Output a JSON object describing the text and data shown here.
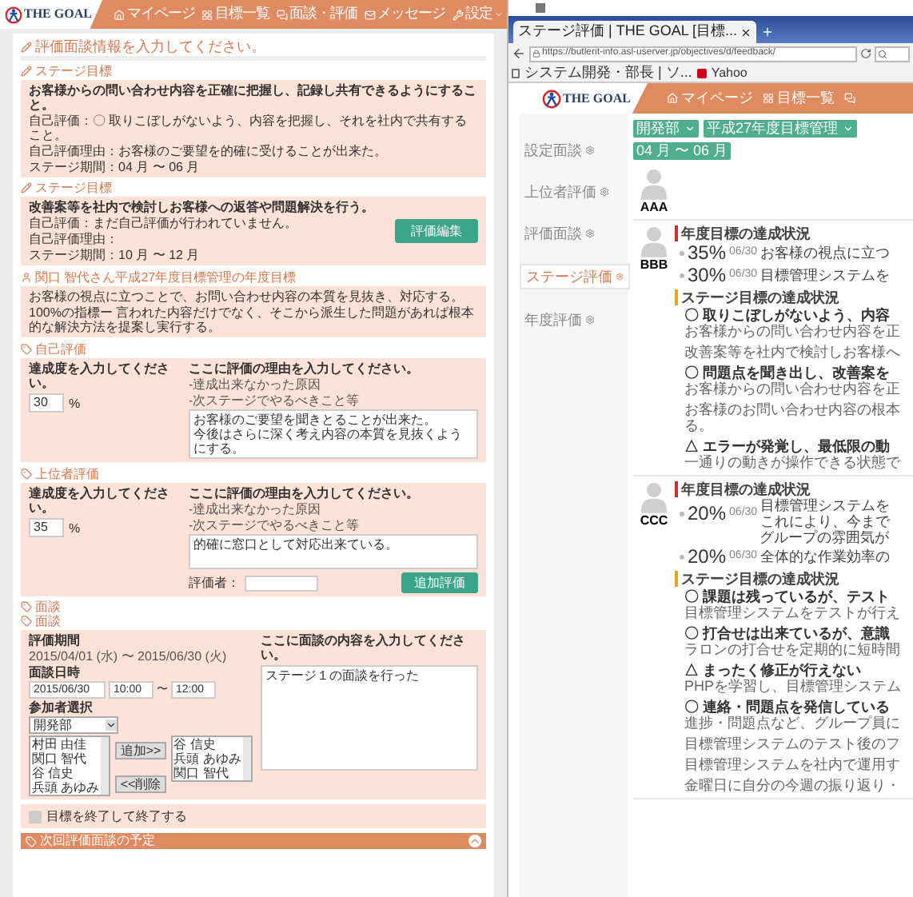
{
  "left": {
    "nav": {
      "logo": "THE GOAL",
      "items": [
        {
          "kind": "home",
          "label": "マイページ",
          "menu": false
        },
        {
          "kind": "grid",
          "label": "目標一覧",
          "menu": false
        },
        {
          "kind": "chat",
          "label": "面談・評価",
          "menu": false
        },
        {
          "kind": "mail",
          "label": "メッセージ",
          "menu": false
        },
        {
          "kind": "wrench",
          "label": "設定",
          "menu": true
        }
      ]
    },
    "title": "評価面談情報を入力してください。",
    "stage_goals": [
      {
        "heading": "ステージ目標",
        "goal": "お客様からの問い合わせ内容を正確に把握し、記録し共有できるようにすること。",
        "lines": [
          "自己評価：〇 取りこぼしがないよう、内容を把握し、それを社内で共有すること。",
          "自己評価理由：お客様のご要望を的確に受けることが出来た。",
          "ステージ期間：04 月 〜 06 月"
        ]
      },
      {
        "heading": "ステージ目標",
        "goal": "改善案等を社内で検討しお客様への返答や問題解決を行う。",
        "lines": [
          "自己評価：まだ自己評価が行われていません。",
          "自己評価理由：",
          "ステージ期間：10 月 〜 12 月"
        ],
        "button": "評価編集"
      }
    ],
    "annual": {
      "heading": "関口 智代さん平成27年度目標管理の年度目標",
      "lines": [
        "お客様の視点に立つことで、お問い合わせ内容の本質を見抜き、対応する。",
        "100%の指標ー 言われた内容だけでなく、そこから派生した問題があれば根本的な解決方法を提案し実行する。"
      ]
    },
    "evaluations": [
      {
        "heading": "自己評価",
        "prompt": "達成度を入力してください。",
        "percent": "30",
        "unit": "%",
        "reason_prompt": "ここに評価の理由を入力してください。",
        "hints": [
          "-達成出来なかった原因",
          "-次ステージでやるべきこと等"
        ],
        "reason": [
          "お客様のご要望を聞きとることが出来た。",
          "今後はさらに深く考え内容の本質を見抜くようにする。"
        ]
      },
      {
        "heading": "上位者評価",
        "prompt": "達成度を入力してください。",
        "percent": "35",
        "unit": "%",
        "reason_prompt": "ここに評価の理由を入力してください。",
        "hints": [
          "-達成出来なかった原因",
          "-次ステージでやるべきこと等"
        ],
        "reason": [
          "的確に窓口として対応出来ている。"
        ],
        "evaluator_label": "評価者：",
        "button": "追加評価"
      }
    ],
    "meeting": {
      "headings": [
        "面談",
        "面談"
      ],
      "period_label": "評価期間",
      "period": "2015/04/01 (水) 〜 2015/06/30 (火)",
      "datetime_label": "面談日時",
      "date": "2015/06/30",
      "start": "10:00",
      "separator": "〜",
      "end": "12:00",
      "participants_label": "参加者選択",
      "department": "開発部",
      "candidates": [
        "村田 由佳",
        "関口 智代",
        "谷 信史",
        "兵頭 あゆみ"
      ],
      "add_button": "追加>>",
      "remove_button": "<<削除",
      "selected": [
        "谷 信史",
        "兵頭 あゆみ",
        "関口 智代"
      ],
      "content_prompt": "ここに面談の内容を入力してください。",
      "content": "ステージ１の面談を行った"
    },
    "finish": {
      "label": "目標を終了して終了する",
      "checked": false
    },
    "next": {
      "heading": "次回評価面談の予定"
    }
  },
  "right": {
    "browser": {
      "tab": "ステージ評価 | THE GOAL [目標...",
      "url": "https://butlerit-info.asl-userver.jp/objectives/d/feedback/",
      "bookmarks": [
        "システム開発・部長 | ソ...",
        "Yahoo"
      ]
    },
    "nav": {
      "logo": "THE GOAL",
      "items": [
        {
          "kind": "home",
          "label": "マイページ"
        },
        {
          "kind": "grid",
          "label": "目標一覧"
        }
      ]
    },
    "filters": [
      {
        "label": "開発部",
        "dropdown": true
      },
      {
        "label": "平成27年度目標管理",
        "dropdown": true
      },
      {
        "label": "04 月 〜 06 月",
        "dropdown": false
      }
    ],
    "sidebar": [
      {
        "label": "設定面談",
        "selected": false
      },
      {
        "label": "上位者評価",
        "selected": false
      },
      {
        "label": "評価面談",
        "selected": false
      },
      {
        "label": "ステージ評価",
        "selected": true
      },
      {
        "label": "年度評価",
        "selected": false
      }
    ],
    "people": [
      {
        "name": "AAA"
      },
      {
        "name": "BBB",
        "annual_heading": "年度目標の達成状況",
        "annual": [
          {
            "percent": "35%",
            "date": "06/30",
            "lines": [
              "お客様の視点に立つ"
            ]
          },
          {
            "percent": "30%",
            "date": "06/30",
            "lines": [
              "目標管理システムを"
            ]
          }
        ],
        "stage_heading": "ステージ目標の達成状況",
        "stage": [
          {
            "title": "〇 取りこぼしがないよう、内容",
            "detail": "お客様からの問い合わせ内容を正"
          },
          {
            "detail": "改善案等を社内で検討しお客様へ"
          },
          {
            "title": "〇 問題点を聞き出し、改善案を",
            "detail": "お客様からの問い合わせ内容を正"
          },
          {
            "detail": "お客様のお問い合わせ内容の根本",
            "detail2": "る。"
          },
          {
            "title": "△ エラーが発覚し、最低限の動",
            "detail": "一通りの動きが操作できる状態で"
          }
        ]
      },
      {
        "name": "CCC",
        "annual_heading": "年度目標の達成状況",
        "annual": [
          {
            "percent": "20%",
            "date": "06/30",
            "lines": [
              "目標管理システムを",
              "これにより、今まで"
            ]
          },
          {
            "lines": [
              "グループの雰囲気が"
            ]
          },
          {
            "percent": "20%",
            "date": "06/30",
            "lines": [
              "全体的な作業効率の"
            ]
          }
        ],
        "stage_heading": "ステージ目標の達成状況",
        "stage": [
          {
            "title": "〇 課題は残っているが、テスト",
            "detail": "目標管理システムをテストが行え"
          },
          {
            "title": "〇 打合せは出来ているが、意識",
            "detail": "ラロンの打合せを定期的に短時間"
          },
          {
            "title": "△ まったく修正が行えない",
            "detail": "PHPを学習し、目標管理システム"
          },
          {
            "title": "〇 連絡・問題点を発信している",
            "detail": "進捗・問題点など、グループ員に"
          },
          {
            "detail": "目標管理システムのテスト後のフ"
          },
          {
            "detail": "目標管理システムを社内で運用す"
          },
          {
            "detail": "金曜日に自分の今週の振り返り・"
          }
        ]
      }
    ]
  }
}
